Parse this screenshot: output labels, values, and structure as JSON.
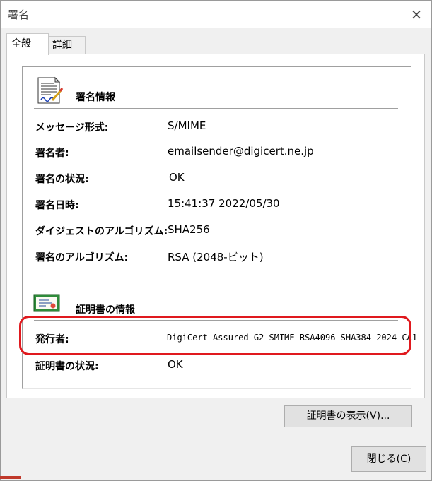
{
  "window": {
    "title": "署名",
    "close_glyph": "×"
  },
  "tabs": [
    {
      "label": "全般",
      "selected": true
    },
    {
      "label": "詳細",
      "selected": false
    }
  ],
  "signature_section": {
    "title": "署名情報",
    "icon": "signed-document-icon",
    "rows": [
      {
        "label": "メッセージ形式:",
        "value": "S/MIME"
      },
      {
        "label": "署名者:",
        "value": "emailsender@digicert.ne.jp"
      },
      {
        "label": "署名の状況:",
        "value": "OK"
      },
      {
        "label": "署名日時:",
        "value": "15:41:37 2022/05/30"
      },
      {
        "label": "ダイジェストのアルゴリズム:",
        "value": "SHA256"
      },
      {
        "label": "署名のアルゴリズム:",
        "value": "RSA (2048-ビット)"
      }
    ]
  },
  "certificate_section": {
    "title": "証明書の情報",
    "icon": "certificate-icon",
    "rows": [
      {
        "label": "発行者:",
        "value": "DigiCert Assured G2 SMIME RSA4096 SHA384 2024 CA1"
      },
      {
        "label": "証明書の状況:",
        "value": "OK"
      }
    ]
  },
  "buttons": {
    "view_certificate": "証明書の表示(V)...",
    "close": "閉じる(C)"
  },
  "colors": {
    "highlight": "#e0191e",
    "button_bg": "#e1e1e1",
    "dialog_bg": "#f0f0f0"
  }
}
